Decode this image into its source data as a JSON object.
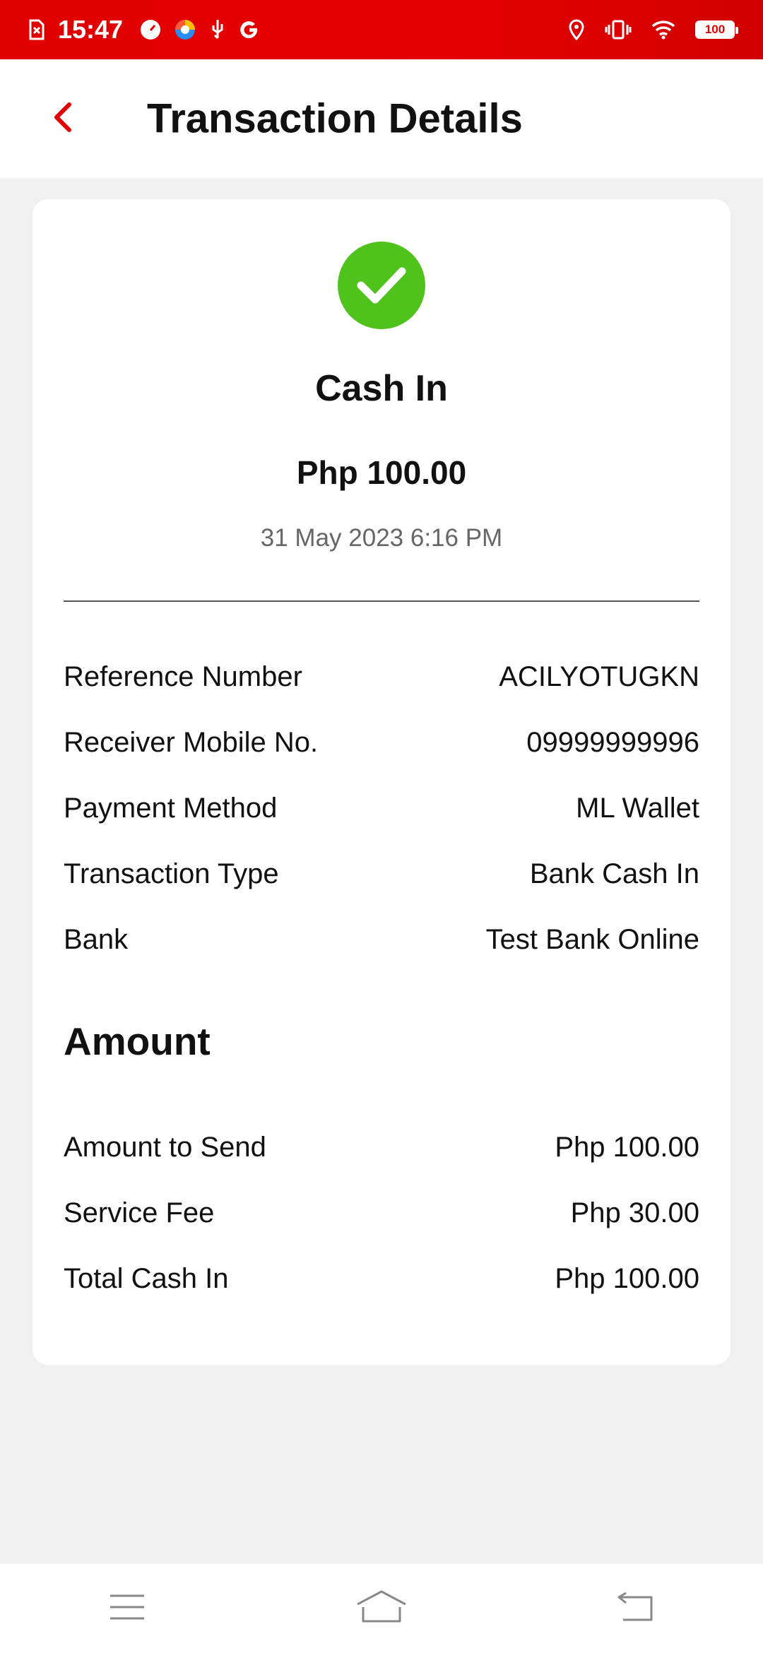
{
  "status_bar": {
    "time": "15:47",
    "battery": "100",
    "left_icons": [
      "sim-error-icon",
      "speedometer-icon",
      "browser-icon",
      "usb-icon",
      "google-icon"
    ],
    "right_icons": [
      "location-icon",
      "vibrate-icon",
      "wifi-icon",
      "battery-icon"
    ]
  },
  "header": {
    "title": "Transaction Details",
    "back_icon": "chevron-left-icon"
  },
  "transaction": {
    "status_icon": "success-check-icon",
    "title": "Cash In",
    "amount": "Php 100.00",
    "datetime": "31 May 2023 6:16 PM",
    "details": [
      {
        "label": "Reference Number",
        "value": "ACILYOTUGKN"
      },
      {
        "label": "Receiver Mobile No.",
        "value": "09999999996"
      },
      {
        "label": "Payment Method",
        "value": "ML Wallet"
      },
      {
        "label": "Transaction Type",
        "value": "Bank Cash In"
      },
      {
        "label": "Bank",
        "value": "Test Bank Online"
      }
    ]
  },
  "amount_section": {
    "title": "Amount",
    "rows": [
      {
        "label": "Amount to Send",
        "value": "Php 100.00"
      },
      {
        "label": "Service Fee",
        "value": "Php 30.00"
      },
      {
        "label": "Total Cash In",
        "value": "Php 100.00"
      }
    ]
  },
  "colors": {
    "accent": "#e00000",
    "success": "#4fc21b",
    "background": "#f0f0f0"
  },
  "nav": [
    "menu-icon",
    "home-icon",
    "back-icon"
  ]
}
